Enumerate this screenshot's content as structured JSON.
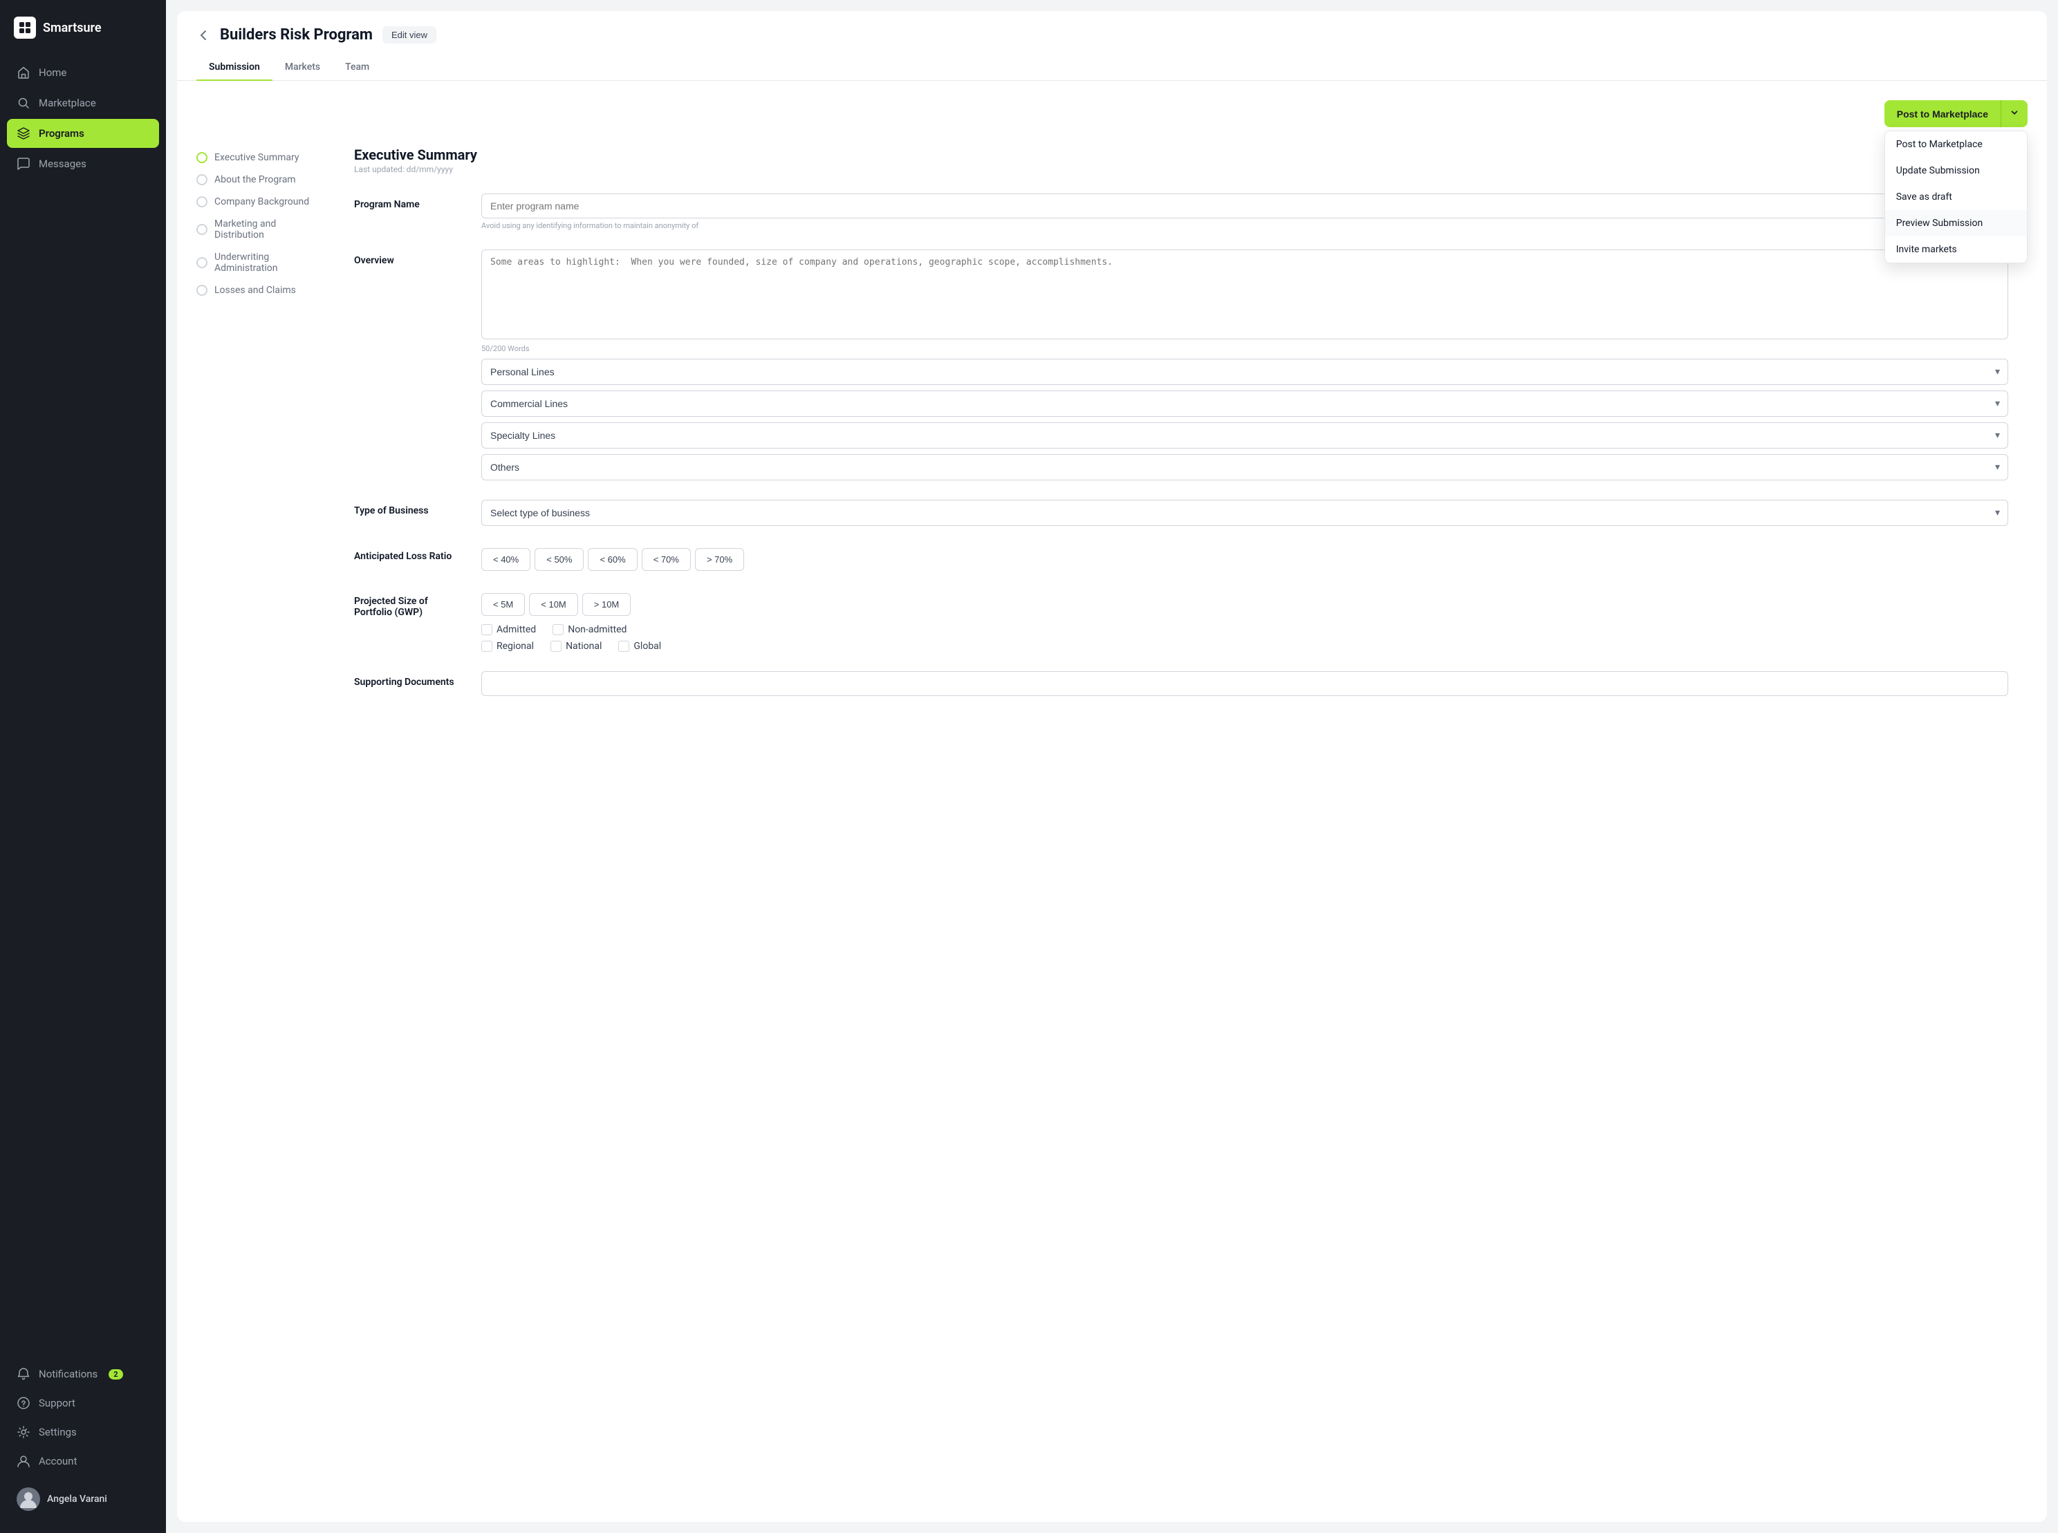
{
  "app": {
    "name": "Smartsure"
  },
  "sidebar": {
    "nav_items": [
      {
        "id": "home",
        "label": "Home",
        "icon": "home"
      },
      {
        "id": "marketplace",
        "label": "Marketplace",
        "icon": "search"
      },
      {
        "id": "programs",
        "label": "Programs",
        "icon": "layers",
        "active": true
      },
      {
        "id": "messages",
        "label": "Messages",
        "icon": "message"
      }
    ],
    "bottom_items": [
      {
        "id": "notifications",
        "label": "Notifications",
        "icon": "bell",
        "badge": "2"
      },
      {
        "id": "support",
        "label": "Support",
        "icon": "circle-question"
      },
      {
        "id": "settings",
        "label": "Settings",
        "icon": "gear"
      },
      {
        "id": "account",
        "label": "Account",
        "icon": "user"
      }
    ],
    "user": {
      "name": "Angela Varani"
    }
  },
  "page": {
    "back_label": "←",
    "title": "Builders Risk Program",
    "edit_view_label": "Edit view",
    "tabs": [
      {
        "id": "submission",
        "label": "Submission",
        "active": true
      },
      {
        "id": "markets",
        "label": "Markets"
      },
      {
        "id": "team",
        "label": "Team"
      }
    ]
  },
  "section_nav": [
    {
      "id": "executive-summary",
      "label": "Executive Summary"
    },
    {
      "id": "about-program",
      "label": "About the Program"
    },
    {
      "id": "company-background",
      "label": "Company Background"
    },
    {
      "id": "marketing-distribution",
      "label": "Marketing and Distribution"
    },
    {
      "id": "underwriting-admin",
      "label": "Underwriting Administration"
    },
    {
      "id": "losses-claims",
      "label": "Losses and Claims"
    }
  ],
  "form": {
    "section_title": "Executive Summary",
    "section_subtitle": "Last updated: dd/mm/yyyy",
    "program_name_label": "Program Name",
    "program_name_placeholder": "Enter program name",
    "program_name_hint": "Avoid using any identifying information to maintain anonymity of",
    "overview_label": "Overview",
    "overview_placeholder": "Some areas to highlight:  When you were founded, size of company and operations, geographic scope, accomplishments.",
    "word_count": "50/200 Words",
    "dropdowns": [
      {
        "id": "personal-lines",
        "label": "Personal Lines"
      },
      {
        "id": "commercial-lines",
        "label": "Commercial Lines"
      },
      {
        "id": "specialty-lines",
        "label": "Specialty Lines"
      },
      {
        "id": "others",
        "label": "Others"
      }
    ],
    "type_of_business_label": "Type of Business",
    "type_of_business_placeholder": "Select type of business",
    "loss_ratio_label": "Anticipated Loss Ratio",
    "loss_ratio_options": [
      "< 40%",
      "< 50%",
      "< 60%",
      "< 70%",
      "> 70%"
    ],
    "portfolio_label": "Projected Size of\nPortfolio (GWP)",
    "portfolio_options": [
      "< 5M",
      "< 10M",
      "> 10M"
    ],
    "checkboxes_row1": [
      {
        "id": "admitted",
        "label": "Admitted"
      },
      {
        "id": "non-admitted",
        "label": "Non-admitted"
      }
    ],
    "checkboxes_row2": [
      {
        "id": "regional",
        "label": "Regional"
      },
      {
        "id": "national",
        "label": "National"
      },
      {
        "id": "global",
        "label": "Global"
      }
    ],
    "supporting_docs_label": "Supporting Documents"
  },
  "action": {
    "post_btn_label": "Post to Marketplace",
    "dropdown_items": [
      {
        "id": "post-marketplace",
        "label": "Post to Marketplace"
      },
      {
        "id": "update-submission",
        "label": "Update Submission"
      },
      {
        "id": "save-draft",
        "label": "Save as draft"
      },
      {
        "id": "preview-submission",
        "label": "Preview Submission",
        "active": true
      },
      {
        "id": "invite-markets",
        "label": "Invite markets"
      }
    ]
  }
}
